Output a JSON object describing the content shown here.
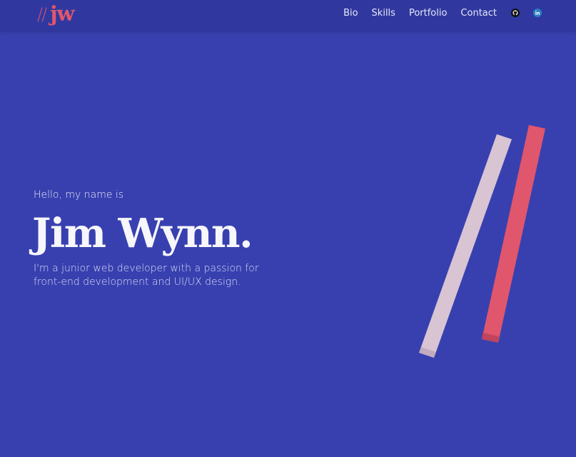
{
  "header": {
    "logo": {
      "slashes": "//",
      "initials": "jw"
    },
    "nav": [
      {
        "label": "Bio"
      },
      {
        "label": "Skills"
      },
      {
        "label": "Portfolio"
      },
      {
        "label": "Contact"
      }
    ],
    "social": [
      {
        "icon": "github-icon"
      },
      {
        "icon": "linkedin-icon",
        "glyph": "in"
      }
    ]
  },
  "hero": {
    "greeting": "Hello, my name is",
    "name": "Jim Wynn.",
    "tagline": "I'm a junior web developer with a passion for front-end development and UI/UX design."
  },
  "colors": {
    "background": "#3840b0",
    "navbar": "#3038a0",
    "accent": "#e0566c",
    "bar_light": "#d8c4d2",
    "bar_accent": "#e0566c"
  }
}
